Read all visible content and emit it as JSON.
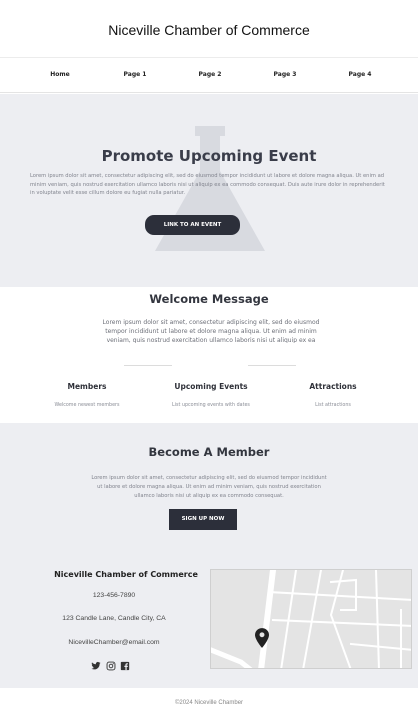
{
  "header": {
    "title": "Niceville Chamber of Commerce"
  },
  "nav": {
    "items": [
      "Home",
      "Page 1",
      "Page 2",
      "Page 3",
      "Page 4"
    ]
  },
  "hero": {
    "title": "Promote Upcoming Event",
    "text": "Lorem ipsum dolor sit amet, consectetur adipiscing elit, sed do eiusmod tempor incididunt ut labore et dolore magna aliqua. Ut enim ad minim veniam, quis nostrud exercitation ullamco laboris nisi ut aliquip ex ea commodo consequat. Duis aute irure dolor in reprehenderit in voluptate velit esse cillum dolore eu fugiat nulla pariatur.",
    "button_label": "LINK TO AN EVENT"
  },
  "welcome": {
    "title": "Welcome Message",
    "text": "Lorem ipsum dolor sit amet, consectetur adipiscing elit, sed do eiusmod tempor incididunt ut labore et dolore magna aliqua. Ut enim ad minim veniam, quis nostrud exercitation ullamco laboris nisi ut aliquip ex ea commodo consequat."
  },
  "features": [
    {
      "title": "Members",
      "desc": "Welcome newest members"
    },
    {
      "title": "Upcoming Events",
      "desc": "List upcoming events with dates"
    },
    {
      "title": "Attractions",
      "desc": "List attractions"
    }
  ],
  "become": {
    "title": "Become A Member",
    "text": "Lorem ipsum dolor sit amet, consectetur adipiscing elit, sed do eiusmod tempor incididunt ut labore et dolore magna aliqua. Ut enim ad minim veniam, quis nostrud exercitation ullamco laboris nisi ut aliquip ex ea commodo consequat.",
    "button_label": "SIGN UP NOW"
  },
  "contact": {
    "name": "Niceville Chamber of Commerce",
    "phone": "123-456-7890",
    "address": "123 Candle Lane, Candle City, CA",
    "email": "NicevilleChamber@email.com",
    "social_icons": [
      "twitter-icon",
      "instagram-icon",
      "facebook-icon"
    ]
  },
  "footer": {
    "text": "©2024 Niceville Chamber"
  },
  "colors": {
    "accent": "#2c2f3a",
    "section_bg": "#edeef2"
  }
}
